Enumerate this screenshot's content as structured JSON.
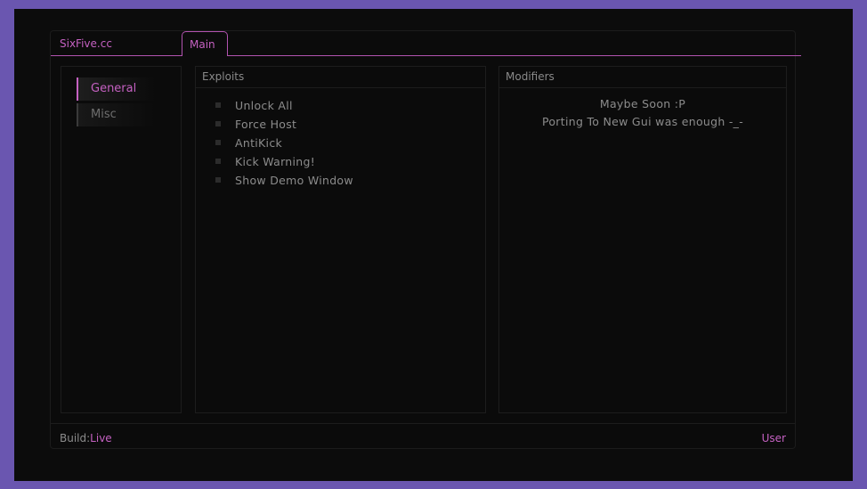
{
  "header": {
    "brand": "SixFive.cc",
    "tabs": [
      {
        "label": "Main",
        "active": true
      }
    ]
  },
  "sidebar": {
    "items": [
      {
        "label": "General",
        "active": true
      },
      {
        "label": "Misc",
        "active": false
      }
    ]
  },
  "exploits": {
    "title": "Exploits",
    "options": [
      {
        "label": "Unlock All",
        "checked": false
      },
      {
        "label": "Force Host",
        "checked": false
      },
      {
        "label": "AntiKick",
        "checked": false
      },
      {
        "label": "Kick Warning!",
        "checked": false
      },
      {
        "label": "Show Demo Window",
        "checked": false
      }
    ]
  },
  "modifiers": {
    "title": "Modifiers",
    "lines": [
      "Maybe Soon :P",
      "Porting To New Gui was enough -_-"
    ]
  },
  "footer": {
    "build_label": "Build:",
    "build_value": "Live",
    "user_label": "User"
  },
  "colors": {
    "accent": "#c561c2",
    "background": "#0b0b0b",
    "outer_border": "#6a56b0"
  }
}
